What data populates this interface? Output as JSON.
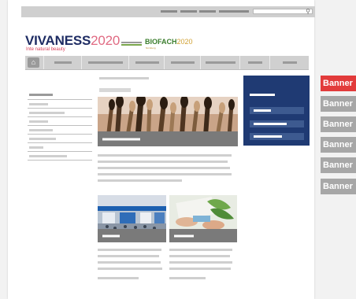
{
  "header": {
    "brand_name": "VIVANESS",
    "brand_year": "2020",
    "tagline": "Inte natural beauty",
    "partner_name": "BIOFACH",
    "partner_year": "2020",
    "partner_sub": "Nürnberg",
    "search_icon": "search-icon"
  },
  "nav": {
    "home_icon": "⌂",
    "home_icon_name": "home-icon"
  },
  "banners": [
    {
      "label": "Banner",
      "color": "#e23b3b"
    },
    {
      "label": "Banner",
      "color": "#a7a7a7"
    },
    {
      "label": "Banner",
      "color": "#a7a7a7"
    },
    {
      "label": "Banner",
      "color": "#a7a7a7"
    },
    {
      "label": "Banner",
      "color": "#a7a7a7"
    },
    {
      "label": "Banner",
      "color": "#a7a7a7"
    }
  ],
  "colors": {
    "brand_blue": "#1e2c63",
    "brand_pink": "#d9405a",
    "box_blue": "#1f3a73",
    "banner_active": "#e23b3b",
    "banner_default": "#a7a7a7"
  }
}
